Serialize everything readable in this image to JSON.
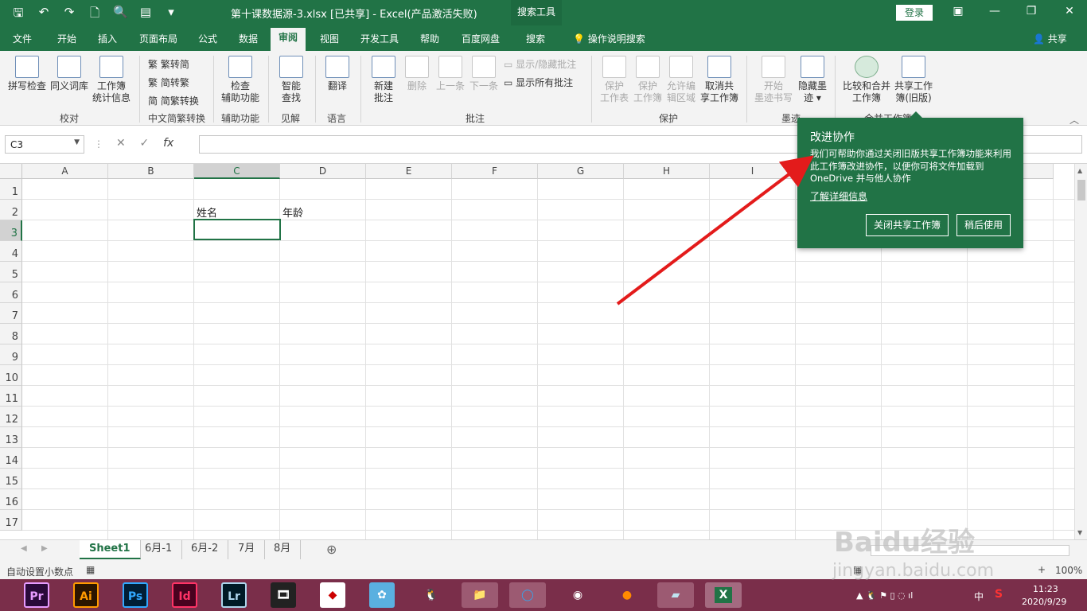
{
  "titlebar": {
    "title": "第十课数据源-3.xlsx  [已共享]  -  Excel(产品激活失败)",
    "context_tab": "搜索工具",
    "login": "登录",
    "qat_icons": [
      "save-icon",
      "undo-icon",
      "redo-icon",
      "new-icon",
      "print-preview-icon",
      "form-icon",
      "customize-icon"
    ],
    "qat_glyphs": [
      "🖫",
      "↶",
      "↷",
      "🗋",
      "🔍",
      "▤",
      "▾"
    ],
    "window_glyphs": [
      "▣",
      "—",
      "❐",
      "✕"
    ]
  },
  "tabs": [
    "文件",
    "开始",
    "插入",
    "页面布局",
    "公式",
    "数据",
    "审阅",
    "视图",
    "开发工具",
    "帮助",
    "百度网盘",
    "搜索"
  ],
  "active_tab": "审阅",
  "tellme": "操作说明搜索",
  "share": "共享",
  "ribbon": {
    "groups": [
      "校对",
      "中文简繁转换",
      "辅助功能",
      "见解",
      "语言",
      "批注",
      "保护",
      "墨迹",
      "合并工作簿"
    ],
    "proofing": [
      "拼写检查",
      "同义词库",
      "工作簿",
      "统计信息"
    ],
    "chinese": [
      "繁转简",
      "简转繁",
      "简繁转换"
    ],
    "access": [
      "检查",
      "辅助功能"
    ],
    "insight": [
      "智能",
      "查找"
    ],
    "lang": "翻译",
    "comments": {
      "new": [
        "新建",
        "批注"
      ],
      "delete": "删除",
      "prev": "上一条",
      "next": "下一条",
      "show_hide": "显示/隐藏批注",
      "show_all": "显示所有批注"
    },
    "protect": {
      "sheet": [
        "保护",
        "工作表"
      ],
      "book": [
        "保护",
        "工作簿"
      ],
      "edit": [
        "允许编",
        "辑区域"
      ],
      "unshare": [
        "取消共",
        "享工作簿"
      ]
    },
    "ink": {
      "start": [
        "开始",
        "墨迹书写"
      ],
      "hide": [
        "隐藏墨",
        "迹 ▾"
      ]
    },
    "merge": {
      "compare": [
        "比较和合并",
        "工作簿"
      ],
      "share": [
        "共享工作",
        "簿(旧版)"
      ]
    }
  },
  "formula_bar": {
    "name_box": "C3",
    "value": ""
  },
  "grid": {
    "columns": [
      "A",
      "B",
      "C",
      "D",
      "E",
      "F",
      "G",
      "H",
      "I",
      "J",
      "K",
      "L"
    ],
    "rows": [
      "1",
      "2",
      "3",
      "4",
      "5",
      "6",
      "7",
      "8",
      "9",
      "10",
      "11",
      "12",
      "13",
      "14",
      "15",
      "16",
      "17"
    ],
    "selected_col": "C",
    "selected_row": "3",
    "cells": {
      "C2": "姓名",
      "D2": "年龄"
    }
  },
  "sheets": [
    "Sheet1",
    "6月-1",
    "6月-2",
    "7月",
    "8月"
  ],
  "active_sheet": "Sheet1",
  "status": {
    "left": "自动设置小数点",
    "zoom": "100%"
  },
  "popup": {
    "title": "改进协作",
    "body": "我们可帮助你通过关闭旧版共享工作簿功能来利用此工作簿改进协作，以便你可将文件加载到 OneDrive 并与他人协作",
    "link": "了解详细信息",
    "btn_close": "关闭共享工作簿",
    "btn_later": "稍后使用"
  },
  "taskbar": {
    "apps": [
      "Pr",
      "Ai",
      "Ps",
      "Id",
      "Lr"
    ],
    "time": "11:23",
    "date": "2020/9/29",
    "ime": "中"
  },
  "watermark": {
    "logo": "Baidu经验",
    "url": "jingyan.baidu.com"
  },
  "colors": {
    "excel_green": "#217346",
    "arrow": "#e31b1b",
    "taskbar": "#7a2e4a"
  }
}
